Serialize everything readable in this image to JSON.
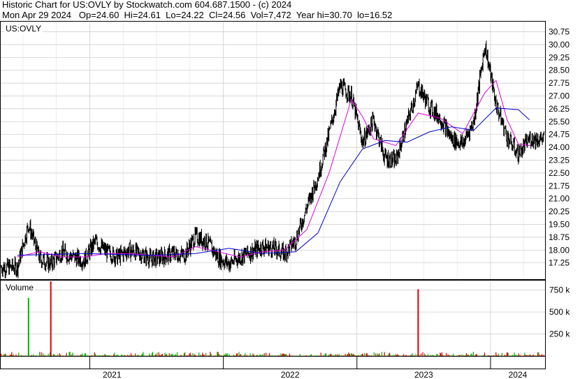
{
  "header": {
    "line1": "Historic Chart for US:OVLY by Stockwatch.com 604.687.1500 - (c) 2024",
    "line2": "Mon Apr 29 2024   Op=24.60  Hi=24.61  Lo=24.22  Cl=24.56  Vol=7,472  Year hi=30.70  lo=16.52"
  },
  "price_panel": {
    "symbol_label": "US:OVLY"
  },
  "volume_panel": {
    "label": "Volume"
  },
  "colors": {
    "bars": "#000000",
    "ma_short": "#e000e0",
    "ma_long": "#0000c8",
    "volume_up": "#00b000",
    "volume_down": "#e00000",
    "grid": "#c8c8c8"
  },
  "chart_data": [
    {
      "type": "line",
      "title": "US:OVLY",
      "x_tick_labels": [
        "2021",
        "2022",
        "2023",
        "2024"
      ],
      "y_ticks": [
        17.25,
        18.0,
        18.75,
        19.5,
        20.25,
        21.0,
        21.75,
        22.5,
        23.25,
        24.0,
        24.75,
        25.5,
        26.25,
        27.0,
        27.75,
        28.5,
        29.25,
        30.0,
        30.75
      ],
      "ylim": [
        16.3,
        31.3
      ],
      "grid": true,
      "series": [
        {
          "key": "price",
          "points": [
            [
              "2020-06",
              17.0
            ],
            [
              "2020-07",
              19.5
            ],
            [
              "2020-08",
              17.5
            ],
            [
              "2020-09",
              17.2
            ],
            [
              "2020-10",
              17.9
            ],
            [
              "2020-11",
              17.6
            ],
            [
              "2020-12",
              17.4
            ],
            [
              "2021-01",
              18.5
            ],
            [
              "2021-02",
              17.9
            ],
            [
              "2021-03",
              17.6
            ],
            [
              "2021-04",
              18.0
            ],
            [
              "2021-05",
              17.8
            ],
            [
              "2021-06",
              17.5
            ],
            [
              "2021-07",
              17.6
            ],
            [
              "2021-08",
              17.8
            ],
            [
              "2021-09",
              17.7
            ],
            [
              "2021-10",
              18.8
            ],
            [
              "2021-11",
              18.5
            ],
            [
              "2021-12",
              17.6
            ],
            [
              "2022-01",
              17.2
            ],
            [
              "2022-02",
              17.6
            ],
            [
              "2022-03",
              17.9
            ],
            [
              "2022-04",
              18.2
            ],
            [
              "2022-05",
              18.1
            ],
            [
              "2022-06",
              17.8
            ],
            [
              "2022-07",
              18.6
            ],
            [
              "2022-08",
              20.5
            ],
            [
              "2022-09",
              22.3
            ],
            [
              "2022-10",
              24.8
            ],
            [
              "2022-11",
              27.6
            ],
            [
              "2022-12",
              27.0
            ],
            [
              "2023-01",
              24.3
            ],
            [
              "2023-02",
              25.6
            ],
            [
              "2023-03",
              23.4
            ],
            [
              "2023-04",
              23.2
            ],
            [
              "2023-05",
              25.4
            ],
            [
              "2023-06",
              27.6
            ],
            [
              "2023-07",
              26.4
            ],
            [
              "2023-08",
              25.7
            ],
            [
              "2023-09",
              24.5
            ],
            [
              "2023-10",
              24.2
            ],
            [
              "2023-11",
              25.5
            ],
            [
              "2023-12",
              30.0
            ],
            [
              "2024-01",
              26.5
            ],
            [
              "2024-02",
              24.6
            ],
            [
              "2024-03",
              23.6
            ],
            [
              "2024-04",
              24.5
            ]
          ]
        },
        {
          "key": "ma_short",
          "points": [
            [
              "2020-06",
              17.6
            ],
            [
              "2020-08",
              17.9
            ],
            [
              "2020-10",
              17.6
            ],
            [
              "2020-12",
              17.6
            ],
            [
              "2021-02",
              17.8
            ],
            [
              "2021-04",
              17.8
            ],
            [
              "2021-06",
              17.7
            ],
            [
              "2021-08",
              17.6
            ],
            [
              "2021-10",
              18.2
            ],
            [
              "2021-12",
              17.9
            ],
            [
              "2022-02",
              17.6
            ],
            [
              "2022-04",
              17.9
            ],
            [
              "2022-06",
              18.0
            ],
            [
              "2022-08",
              19.2
            ],
            [
              "2022-10",
              22.5
            ],
            [
              "2022-12",
              26.8
            ],
            [
              "2023-01",
              25.8
            ],
            [
              "2023-02",
              24.5
            ],
            [
              "2023-04",
              24.1
            ],
            [
              "2023-06",
              26.0
            ],
            [
              "2023-08",
              25.7
            ],
            [
              "2023-10",
              24.8
            ],
            [
              "2023-12",
              27.2
            ],
            [
              "2024-01",
              27.9
            ],
            [
              "2024-02",
              25.6
            ],
            [
              "2024-03",
              24.2
            ],
            [
              "2024-04",
              24.1
            ]
          ]
        },
        {
          "key": "ma_long",
          "points": [
            [
              "2020-06",
              17.7
            ],
            [
              "2020-12",
              17.8
            ],
            [
              "2021-06",
              17.7
            ],
            [
              "2021-10",
              17.8
            ],
            [
              "2022-01",
              18.1
            ],
            [
              "2022-04",
              17.8
            ],
            [
              "2022-07",
              17.9
            ],
            [
              "2022-09",
              19.0
            ],
            [
              "2022-11",
              22.0
            ],
            [
              "2023-01",
              23.9
            ],
            [
              "2023-03",
              24.4
            ],
            [
              "2023-05",
              24.3
            ],
            [
              "2023-07",
              24.9
            ],
            [
              "2023-09",
              25.2
            ],
            [
              "2023-11",
              25.0
            ],
            [
              "2024-01",
              26.3
            ],
            [
              "2024-03",
              26.2
            ],
            [
              "2024-04",
              25.6
            ]
          ]
        }
      ]
    },
    {
      "type": "bar",
      "title": "Volume",
      "y_tick_labels": [
        "250 k",
        "500 k",
        "750 k"
      ],
      "y_ticks": [
        250000,
        500000,
        750000
      ],
      "ylim": [
        0,
        850000
      ],
      "spikes": [
        [
          "2020-07",
          660000,
          "up"
        ],
        [
          "2020-09",
          870000,
          "down"
        ],
        [
          "2022-12",
          30000,
          "up"
        ],
        [
          "2023-01",
          25000,
          "down"
        ],
        [
          "2023-06",
          760000,
          "down"
        ],
        [
          "2023-08",
          35000,
          "down"
        ],
        [
          "2024-02",
          40000,
          "down"
        ]
      ]
    }
  ]
}
